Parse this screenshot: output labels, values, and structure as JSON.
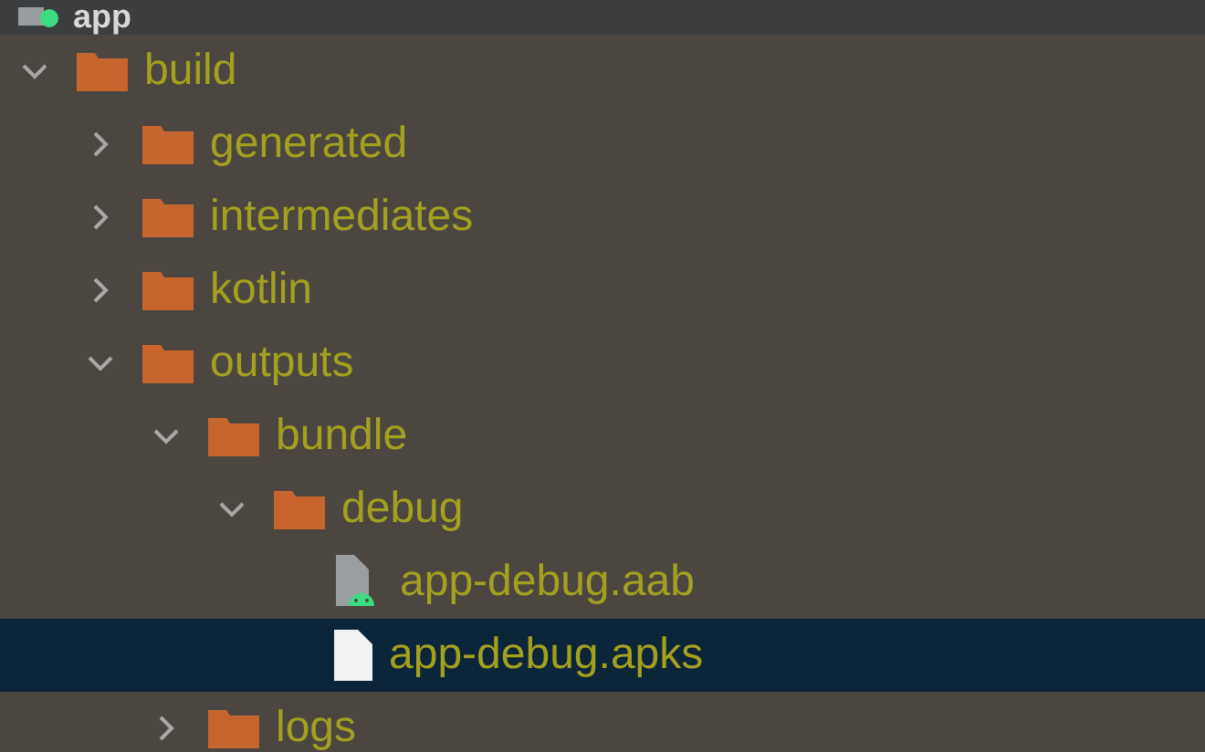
{
  "header": {
    "label": "app"
  },
  "tree": [
    {
      "kind": "folder",
      "label": "build",
      "expanded": true,
      "selected": false,
      "children": [
        {
          "kind": "folder",
          "label": "generated",
          "expanded": false,
          "selected": false
        },
        {
          "kind": "folder",
          "label": "intermediates",
          "expanded": false,
          "selected": false
        },
        {
          "kind": "folder",
          "label": "kotlin",
          "expanded": false,
          "selected": false
        },
        {
          "kind": "folder",
          "label": "outputs",
          "expanded": true,
          "selected": false,
          "children": [
            {
              "kind": "folder",
              "label": "bundle",
              "expanded": true,
              "selected": false,
              "children": [
                {
                  "kind": "folder",
                  "label": "debug",
                  "expanded": true,
                  "selected": false,
                  "children": [
                    {
                      "kind": "bundle-file",
                      "label": "app-debug.aab",
                      "selected": false
                    },
                    {
                      "kind": "file",
                      "label": "app-debug.apks",
                      "selected": true
                    }
                  ]
                }
              ]
            },
            {
              "kind": "folder",
              "label": "logs",
              "expanded": false,
              "selected": false
            }
          ]
        }
      ]
    }
  ]
}
